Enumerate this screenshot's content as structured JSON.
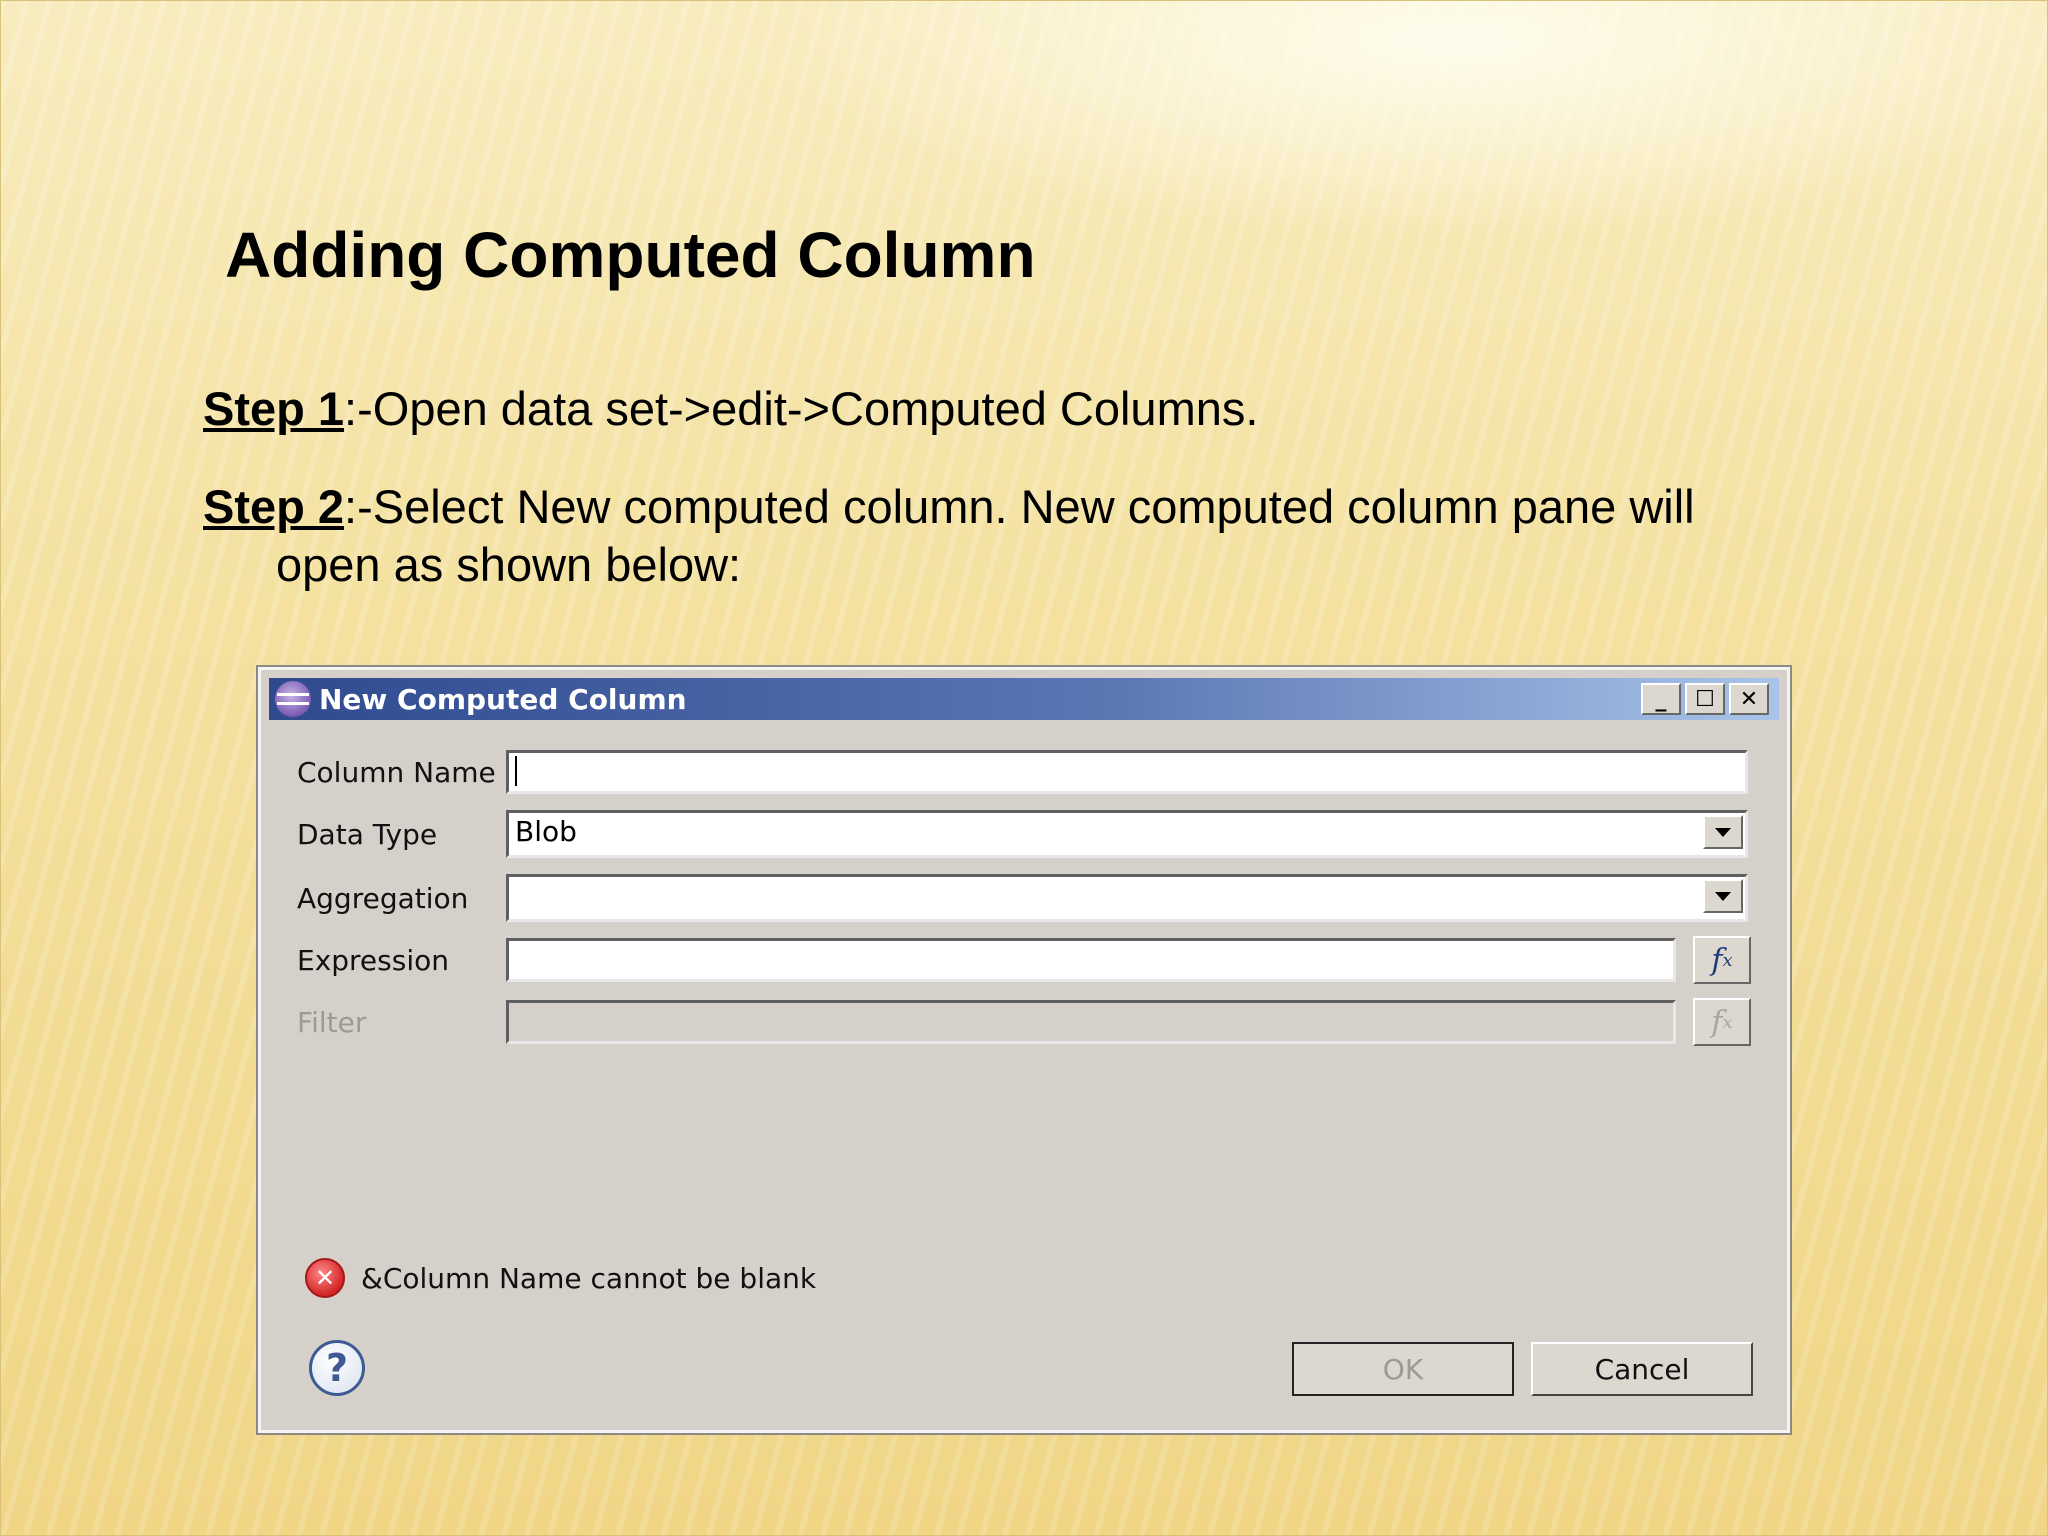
{
  "slide": {
    "title": "Adding Computed Column",
    "step1": {
      "label": "Step 1",
      "text": ":-Open data set->edit->Computed Columns."
    },
    "step2": {
      "label": "Step 2",
      "text": ":-Select New computed column. New computed column pane will",
      "cont": "open as shown below:"
    }
  },
  "dialog": {
    "title": "New Computed Column",
    "window_buttons": {
      "minimize": "_",
      "maximize": "☐",
      "close": "✕"
    },
    "fields": {
      "column_name": {
        "label": "Column Name",
        "value": ""
      },
      "data_type": {
        "label": "Data Type",
        "value": "Blob"
      },
      "aggregation": {
        "label": "Aggregation",
        "value": ""
      },
      "expression": {
        "label": "Expression",
        "value": ""
      },
      "filter": {
        "label": "Filter",
        "value": ""
      }
    },
    "fx_label": "f",
    "fx_sub": "x",
    "error": {
      "icon": "✕",
      "message": "&Column Name cannot be blank"
    },
    "help_icon": "?",
    "buttons": {
      "ok": "OK",
      "cancel": "Cancel"
    }
  }
}
